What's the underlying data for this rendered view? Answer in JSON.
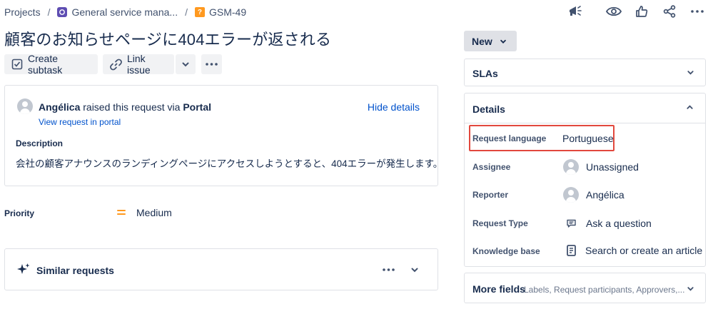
{
  "breadcrumb": {
    "projects": "Projects",
    "project": "General service mana...",
    "issue_key": "GSM-49"
  },
  "issue": {
    "title": "顧客のお知らせページに404エラーが返される"
  },
  "toolbar": {
    "create_subtask": "Create subtask",
    "link_issue": "Link issue"
  },
  "request": {
    "reporter_name": "Angélica",
    "raised_text": " raised this request via ",
    "channel": "Portal",
    "view_in_portal": "View request in portal",
    "hide_details": "Hide details",
    "description_label": "Description",
    "description": "会社の顧客アナウンスのランディングページにアクセスしようとすると、404エラーが発生します。"
  },
  "priority": {
    "label": "Priority",
    "value": "Medium",
    "color": "#ff991f"
  },
  "similar": {
    "label": "Similar requests"
  },
  "status": {
    "label": "New"
  },
  "panels": {
    "slas": "SLAs",
    "details": "Details",
    "more_fields": "More fields",
    "more_fields_hint": "Labels, Request participants, Approvers,..."
  },
  "details": {
    "request_language_label": "Request language",
    "request_language_value": "Portuguese",
    "assignee_label": "Assignee",
    "assignee_value": "Unassigned",
    "reporter_label": "Reporter",
    "reporter_value": "Angélica",
    "request_type_label": "Request Type",
    "request_type_value": "Ask a question",
    "knowledge_base_label": "Knowledge base",
    "knowledge_base_value": "Search or create an article"
  },
  "colors": {
    "highlight_border": "#e2483d",
    "link": "#0052cc",
    "text": "#172b4d"
  }
}
